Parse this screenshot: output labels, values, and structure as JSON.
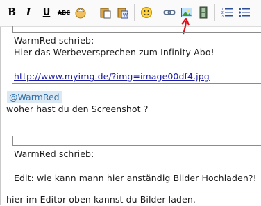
{
  "toolbar": {
    "bold_label": "B",
    "italic_label": "I",
    "underline_label": "U",
    "strike_label": "ABC"
  },
  "quote1": {
    "header": "WarmRed schrieb:",
    "line1": "Hier das Werbeversprechen zum Infinity Abo!",
    "link": "http://www.myimg.de/?img=image00df4.jpg"
  },
  "mention": "@WarmRed",
  "reply1": "woher hast du den Screenshot ?",
  "quote2": {
    "header": "WarmRed schrieb:",
    "line1": "Edit: wie kann mann hier anständig Bilder Hochladen?!"
  },
  "reply2": "hier im Editor oben kannst du Bilder laden.",
  "colors": {
    "arrow": "#e0101a",
    "link": "#1a1aa8",
    "mention_bg": "#dbe9f5"
  }
}
